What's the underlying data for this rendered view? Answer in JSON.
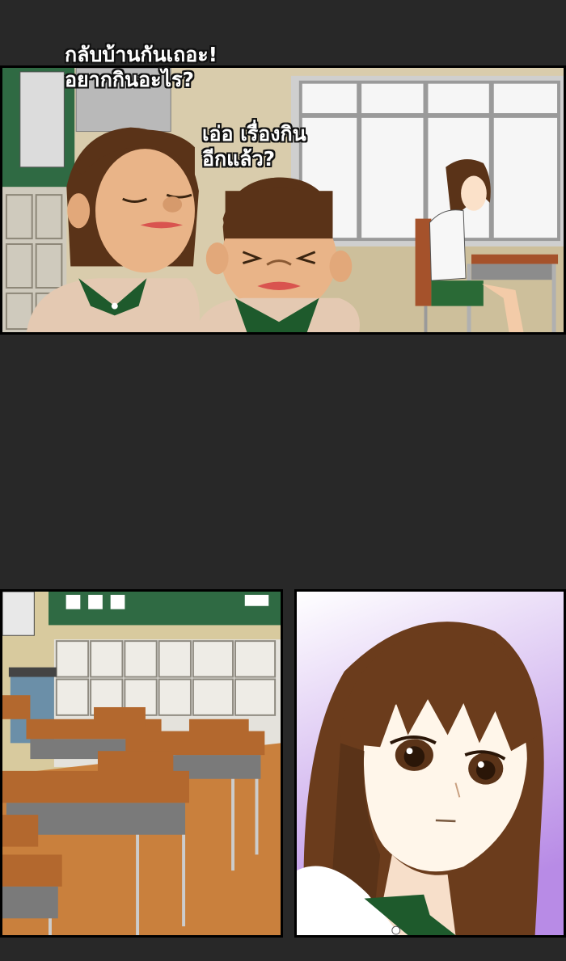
{
  "panels": {
    "top": {
      "dialogue_1": [
        "กลับบ้านกันเถอะ!",
        "อยากกินอะไร?"
      ],
      "dialogue_2": [
        "เอ่อ เรื่องกิน",
        "อีกแล้ว?"
      ]
    }
  },
  "colors": {
    "background": "#282828",
    "uniform_green": "#1e5a2c",
    "hair_brown": "#5a3318",
    "skin": "#e9b488",
    "desk_wood": "#b3682e",
    "portrait_bg": "#c9a1e8"
  }
}
